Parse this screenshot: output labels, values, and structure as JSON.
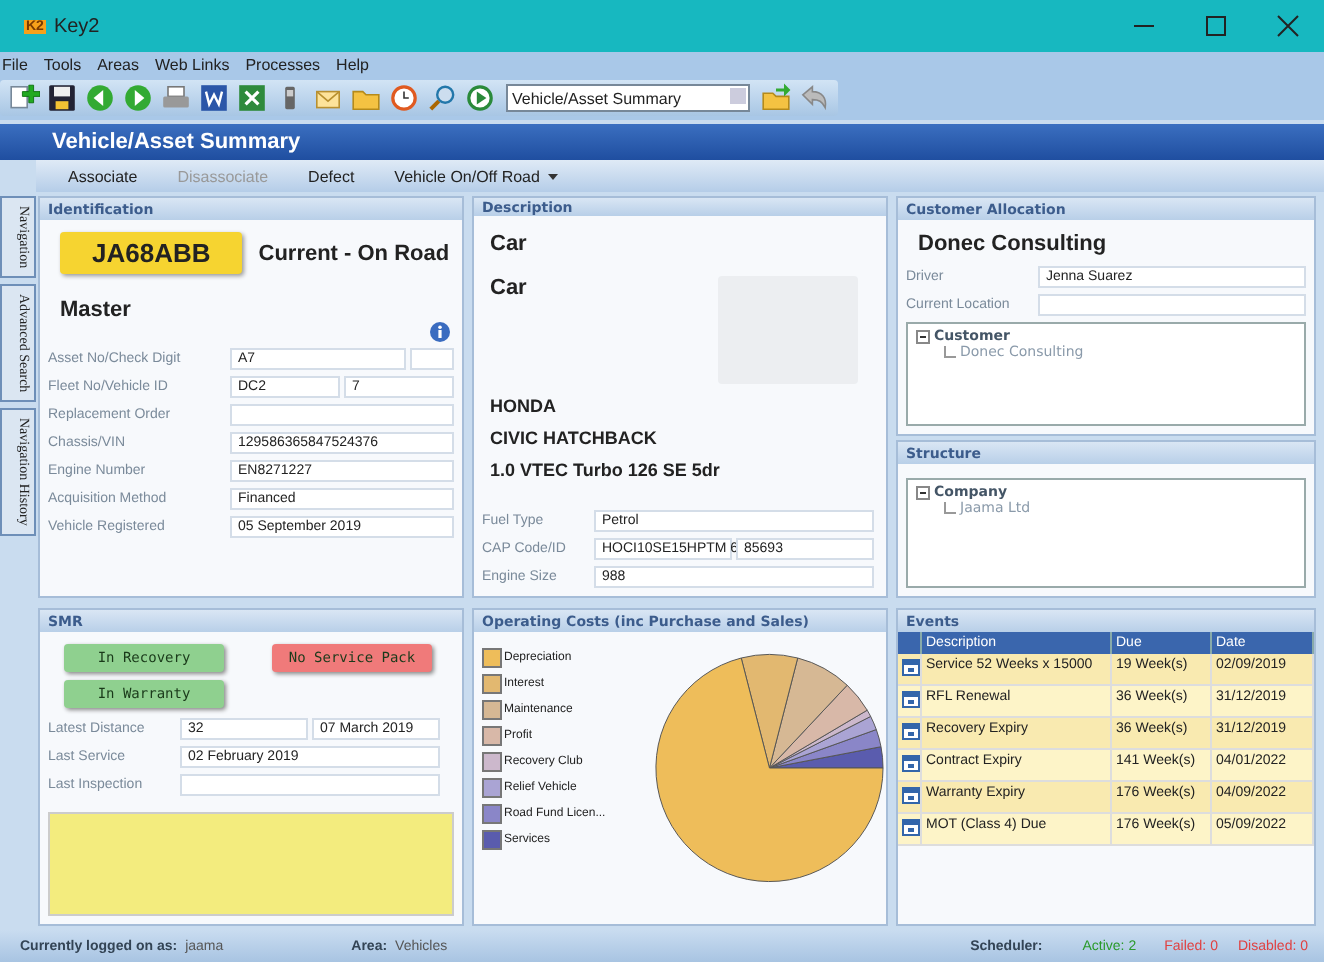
{
  "window": {
    "logo": "K2",
    "title": "Key2"
  },
  "menu": [
    "File",
    "Tools",
    "Areas",
    "Web Links",
    "Processes",
    "Help"
  ],
  "toolbar": {
    "view_select": "Vehicle/Asset Summary"
  },
  "page_title": "Vehicle/Asset Summary",
  "actions": [
    {
      "label": "Associate",
      "disabled": false,
      "dropdown": false
    },
    {
      "label": "Disassociate",
      "disabled": true,
      "dropdown": false
    },
    {
      "label": "Defect",
      "disabled": false,
      "dropdown": false
    },
    {
      "label": "Vehicle On/Off Road",
      "disabled": false,
      "dropdown": true
    }
  ],
  "side_tabs": [
    "Navigation",
    "Advanced Search",
    "Navigation History"
  ],
  "identification": {
    "title": "Identification",
    "registration": "JA68ABB",
    "status": "Current - On Road",
    "model": "Master",
    "fields": [
      {
        "label": "Asset No/Check Digit",
        "kind": "wide-narrow",
        "values": [
          "A7"
        ]
      },
      {
        "label": "Fleet No/Vehicle ID",
        "kind": "half",
        "values": [
          "DC2",
          "7"
        ]
      },
      {
        "label": "Replacement Order",
        "kind": "single"
      },
      {
        "label": "Chassis/VIN",
        "kind": "single",
        "values": [
          "129586365847524376"
        ]
      },
      {
        "label": "Engine Number",
        "kind": "single",
        "values": [
          "EN8271227"
        ]
      },
      {
        "label": "Acquisition Method",
        "kind": "single",
        "values": [
          "Financed"
        ]
      },
      {
        "label": "Vehicle Registered",
        "kind": "single",
        "values": [
          "05 September 2019"
        ]
      }
    ]
  },
  "description": {
    "title": "Description",
    "type": "Car",
    "body_type": "Car",
    "make": "HONDA",
    "model": "CIVIC HATCHBACK",
    "variant": "1.0 VTEC Turbo 126 SE 5dr",
    "fields": [
      {
        "label": "Fuel Type",
        "kind": "single",
        "values": [
          "Petrol"
        ]
      },
      {
        "label": "CAP Code/ID",
        "kind": "half",
        "values": [
          "HOCI10SE15HPTM 6",
          "85693"
        ]
      },
      {
        "label": "Engine Size",
        "kind": "single",
        "values": [
          "988"
        ]
      }
    ]
  },
  "customer_allocation": {
    "title": "Customer Allocation",
    "customer": "Donec Consulting",
    "fields": [
      {
        "label": "Driver",
        "values": [
          "Jenna Suarez"
        ]
      },
      {
        "label": "Current Location"
      }
    ],
    "tree": [
      {
        "label": "Customer",
        "expanded": true,
        "children": [
          {
            "label": "Donec Consulting"
          }
        ]
      }
    ]
  },
  "structure": {
    "title": "Structure",
    "tree": [
      {
        "label": "Company",
        "expanded": true,
        "children": [
          {
            "label": "Jaama Ltd"
          }
        ]
      }
    ]
  },
  "smr": {
    "title": "SMR",
    "badges": [
      {
        "label": "In Recovery",
        "color": "#8fd08f"
      },
      {
        "label": "No Service Pack",
        "color": "#f07a7a"
      },
      {
        "label": "In Warranty",
        "color": "#8fd08f"
      }
    ],
    "fields": [
      {
        "label": "Latest Distance",
        "kind": "half",
        "values": [
          "32",
          "07 March 2019"
        ]
      },
      {
        "label": "Last Service",
        "kind": "single",
        "values": [
          "02 February 2019"
        ]
      },
      {
        "label": "Last Inspection",
        "kind": "single"
      }
    ]
  },
  "operating_costs": {
    "title": "Operating Costs (inc Purchase and Sales)",
    "legend": [
      {
        "label": "Depreciation",
        "color": "#eebd5a"
      },
      {
        "label": "Interest",
        "color": "#e2b870"
      },
      {
        "label": "Maintenance",
        "color": "#d6b894"
      },
      {
        "label": "Profit",
        "color": "#d8b8a8"
      },
      {
        "label": "Recovery Club",
        "color": "#ccb8cc"
      },
      {
        "label": "Relief Vehicle",
        "color": "#aaa4d4"
      },
      {
        "label": "Road Fund Licen...",
        "color": "#8a86c8"
      },
      {
        "label": "Services",
        "color": "#5a5cae"
      }
    ]
  },
  "events": {
    "title": "Events",
    "columns": [
      "Description",
      "Due",
      "Date"
    ],
    "rows": [
      {
        "cells": [
          "Service 52 Weeks x 15000",
          "19 Week(s)",
          "02/09/2019"
        ]
      },
      {
        "cells": [
          "RFL Renewal",
          "36 Week(s)",
          "31/12/2019"
        ]
      },
      {
        "cells": [
          "Recovery Expiry",
          "36 Week(s)",
          "31/12/2019"
        ]
      },
      {
        "cells": [
          "Contract Expiry",
          "141 Week(s)",
          "04/01/2022"
        ]
      },
      {
        "cells": [
          "Warranty Expiry",
          "176 Week(s)",
          "04/09/2022"
        ]
      },
      {
        "cells": [
          "MOT (Class 4) Due",
          "176 Week(s)",
          "05/09/2022"
        ]
      }
    ]
  },
  "status_bar": {
    "user_label": "Currently logged on as:",
    "user": "jaama",
    "area_label": "Area:",
    "area": "Vehicles",
    "scheduler_label": "Scheduler:",
    "active": "Active: 2",
    "failed": "Failed: 0",
    "disabled": "Disabled: 0"
  }
}
